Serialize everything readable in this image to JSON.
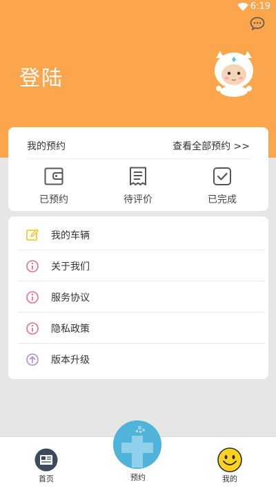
{
  "status_bar": {
    "time": "6:19"
  },
  "header": {
    "title": "登陆",
    "colors": {
      "background": "#fba64c"
    }
  },
  "orders": {
    "title": "我的预约",
    "view_all": "查看全部预约 >>",
    "items": [
      {
        "label": "已预约",
        "icon": "wallet-icon"
      },
      {
        "label": "待评价",
        "icon": "receipt-icon"
      },
      {
        "label": "已完成",
        "icon": "check-box-icon"
      }
    ]
  },
  "menu": {
    "items": [
      {
        "label": "我的车辆",
        "icon": "edit-icon"
      },
      {
        "label": "关于我们",
        "icon": "info-icon"
      },
      {
        "label": "服务协议",
        "icon": "info-icon"
      },
      {
        "label": "隐私政策",
        "icon": "info-icon"
      },
      {
        "label": "版本升级",
        "icon": "upgrade-icon"
      }
    ]
  },
  "tabbar": {
    "items": [
      {
        "label": "首页",
        "icon": "news-icon"
      },
      {
        "label": "预约",
        "icon": "medical-cross-icon"
      },
      {
        "label": "我的",
        "icon": "smiley-icon"
      }
    ],
    "active": "我的"
  }
}
